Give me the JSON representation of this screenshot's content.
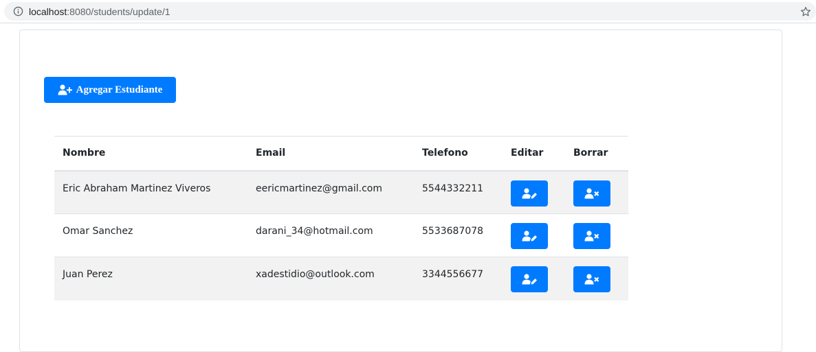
{
  "browser": {
    "url_host": "localhost",
    "url_rest": ":8080/students/update/1",
    "info_icon": "info-circle-icon",
    "bookmark_icon": "star-icon"
  },
  "toolbar": {
    "add_label": "Agregar Estudiante",
    "add_icon": "user-plus-icon"
  },
  "table": {
    "headers": {
      "nombre": "Nombre",
      "email": "Email",
      "telefono": "Telefono",
      "editar": "Editar",
      "borrar": "Borrar"
    },
    "rows": [
      {
        "nombre": "Eric Abraham Martinez Viveros",
        "email": "eericmartinez@gmail.com",
        "telefono": "5544332211"
      },
      {
        "nombre": "Omar Sanchez",
        "email": "darani_34@hotmail.com",
        "telefono": "5533687078"
      },
      {
        "nombre": "Juan Perez",
        "email": "xadestidio@outlook.com",
        "telefono": "3344556677"
      }
    ],
    "edit_icon": "user-edit-icon",
    "delete_icon": "user-times-icon"
  },
  "colors": {
    "primary": "#007bff",
    "stripe": "#f2f2f2",
    "border": "#dee2e6"
  }
}
